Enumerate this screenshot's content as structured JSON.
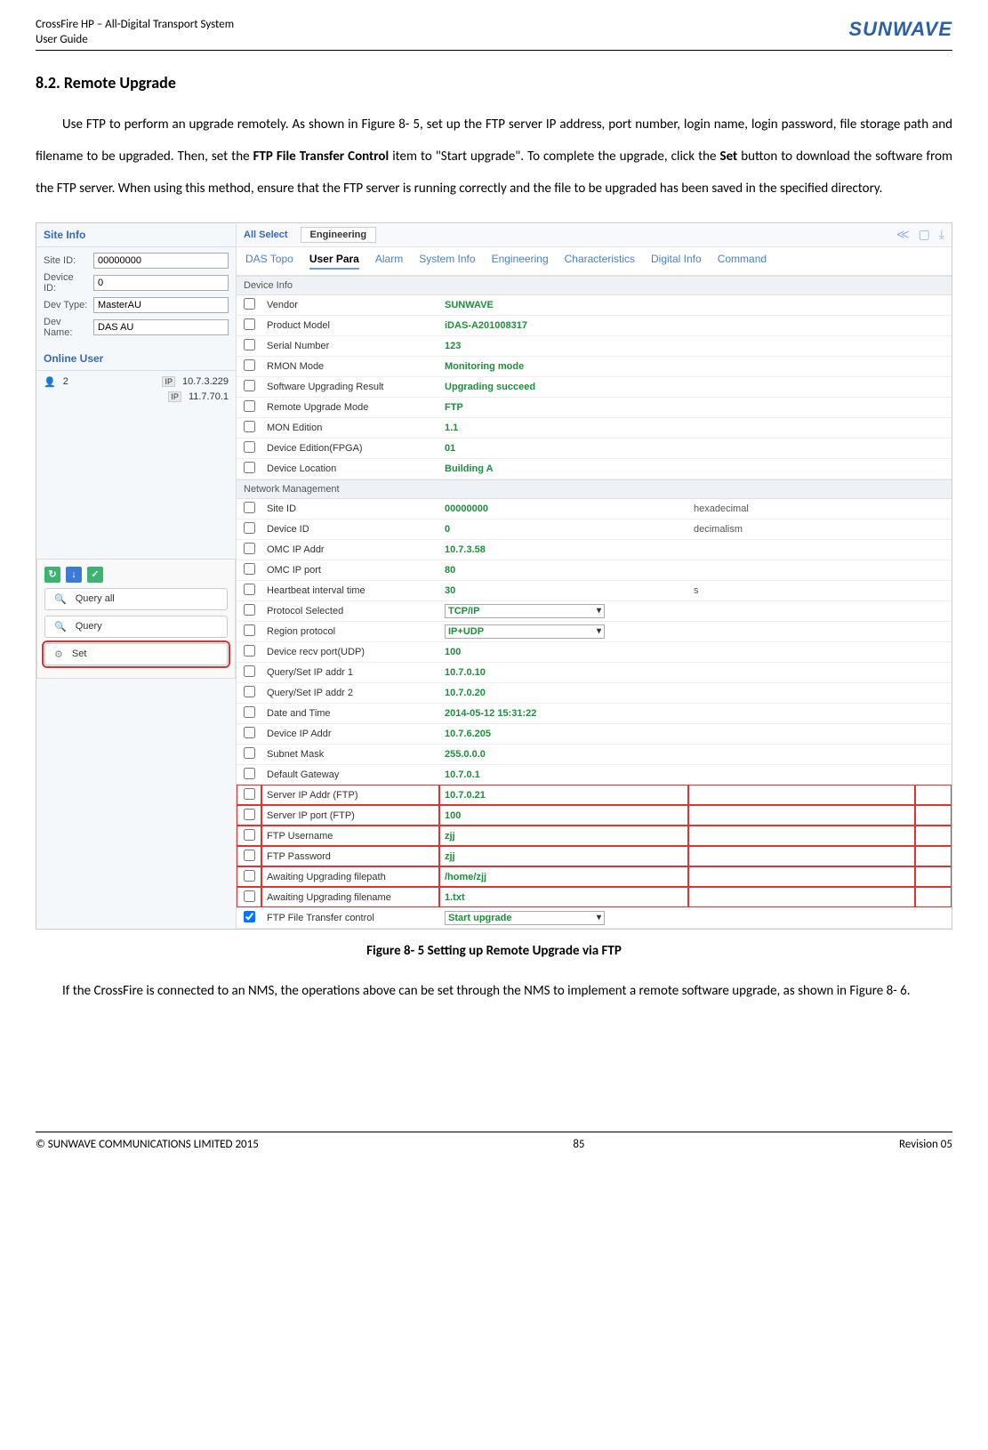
{
  "header": {
    "line1": "CrossFire HP – All-Digital Transport System",
    "line2": "User Guide",
    "brand": "SUNWAVE"
  },
  "section_title": "8.2.   Remote Upgrade",
  "para1_a": "Use FTP to perform an upgrade remotely. As shown in Figure 8- 5, set up the FTP server IP address, port number, login name, login password, file storage path and filename to be upgraded. Then, set the ",
  "para1_b": "FTP File Transfer Control",
  "para1_c": " item to \"Start upgrade\". To complete the upgrade, click the ",
  "para1_d": "Set",
  "para1_e": " button to download the software from the FTP server. When using this method, ensure that the FTP server is running correctly and the file to be upgraded has been saved in the specified directory.",
  "siteinfo": {
    "title": "Site Info",
    "site_id_lbl": "Site ID:",
    "site_id_val": "00000000",
    "device_id_lbl": "Device ID:",
    "device_id_val": "0",
    "dev_type_lbl": "Dev Type:",
    "dev_type_val": "MasterAU",
    "dev_name_lbl": "Dev Name:",
    "dev_name_val": "DAS AU"
  },
  "online": {
    "title": "Online User",
    "count": "2",
    "ip1": "10.7.3.229",
    "ip2": "11.7.70.1",
    "ip_lbl": "IP"
  },
  "btns": {
    "query_all": "Query all",
    "query": "Query",
    "set": "Set"
  },
  "topbar": {
    "all": "All Select",
    "eng": "Engineering"
  },
  "tabs": {
    "t1": "DAS Topo",
    "t2": "User Para",
    "t3": "Alarm",
    "t4": "System Info",
    "t5": "Engineering",
    "t6": "Characteristics",
    "t7": "Digital Info",
    "t8": "Command"
  },
  "group1": "Device Info",
  "rows1": [
    {
      "n": "Vendor",
      "v": "SUNWAVE"
    },
    {
      "n": "Product Model",
      "v": "iDAS-A201008317"
    },
    {
      "n": "Serial Number",
      "v": "123"
    },
    {
      "n": "RMON Mode",
      "v": "Monitoring mode"
    },
    {
      "n": "Software Upgrading Result",
      "v": "Upgrading succeed"
    },
    {
      "n": "Remote Upgrade Mode",
      "v": "FTP"
    },
    {
      "n": "MON Edition",
      "v": "1.1"
    },
    {
      "n": "Device Edition(FPGA)",
      "v": "01"
    },
    {
      "n": "Device Location",
      "v": "Building A"
    }
  ],
  "group2": "Network Management",
  "rows2": [
    {
      "n": "Site ID",
      "v": "00000000",
      "e": "hexadecimal"
    },
    {
      "n": "Device ID",
      "v": "0",
      "e": "decimalism"
    },
    {
      "n": "OMC IP Addr",
      "v": "10.7.3.58"
    },
    {
      "n": "OMC IP port",
      "v": "80"
    },
    {
      "n": "Heartbeat interval time",
      "v": "30",
      "e": "s"
    },
    {
      "n": "Protocol Selected",
      "v": "TCP/IP",
      "sel": true
    },
    {
      "n": "Region protocol",
      "v": "IP+UDP",
      "sel": true
    },
    {
      "n": "Device recv port(UDP)",
      "v": "100"
    },
    {
      "n": "Query/Set IP addr 1",
      "v": "10.7.0.10"
    },
    {
      "n": "Query/Set IP addr 2",
      "v": "10.7.0.20"
    },
    {
      "n": "Date and Time",
      "v": "2014-05-12 15:31:22"
    },
    {
      "n": "Device IP Addr",
      "v": "10.7.6.205"
    },
    {
      "n": "Subnet Mask",
      "v": "255.0.0.0"
    },
    {
      "n": "Default Gateway",
      "v": "10.7.0.1"
    },
    {
      "n": "Server IP Addr (FTP)",
      "v": "10.7.0.21",
      "hl": true
    },
    {
      "n": "Server IP port (FTP)",
      "v": "100",
      "hl": true
    },
    {
      "n": "FTP Username",
      "v": "zjj",
      "hl": true
    },
    {
      "n": "FTP Password",
      "v": "zjj",
      "hl": true
    },
    {
      "n": "Awaiting Upgrading filepath",
      "v": "/home/zjj",
      "hl": true
    },
    {
      "n": "Awaiting Upgrading filename",
      "v": "1.txt",
      "hl": true
    },
    {
      "n": "FTP File Transfer control",
      "v": "Start upgrade",
      "sel": true,
      "checked": true
    }
  ],
  "fig_caption": "Figure 8- 5 Setting up Remote Upgrade via FTP",
  "para2": "If the CrossFire is connected to an NMS, the operations above can be set through the NMS to implement a remote software upgrade, as shown in Figure 8- 6.",
  "footer": {
    "left": "© SUNWAVE COMMUNICATIONS LIMITED 2015",
    "center": "85",
    "right": "Revision 05"
  }
}
